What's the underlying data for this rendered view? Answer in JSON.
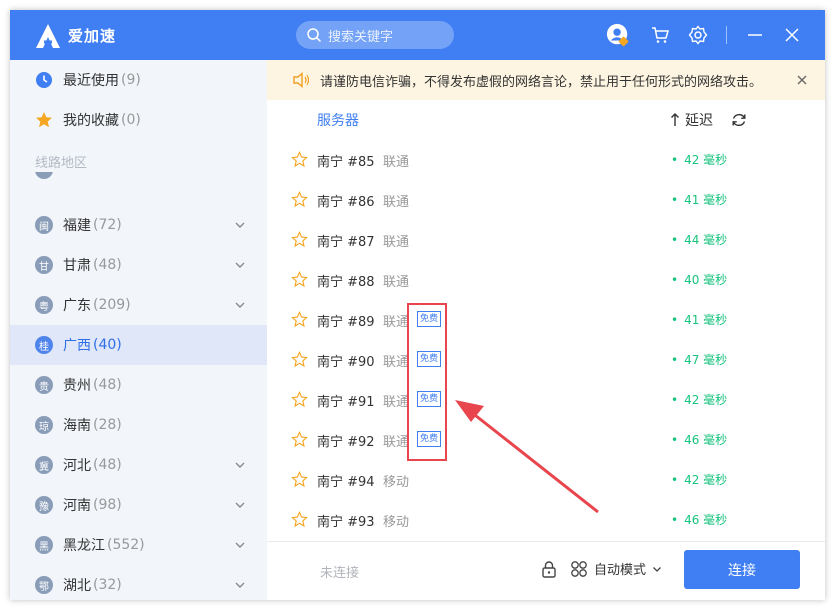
{
  "header": {
    "app_title": "爱加速",
    "search_placeholder": "搜索关键字"
  },
  "sidebar": {
    "recent": {
      "label": "最近使用",
      "count": "(9)"
    },
    "favorites": {
      "label": "我的收藏",
      "count": "(0)"
    },
    "section_title": "线路地区",
    "provinces": [
      {
        "badge": "闽",
        "label": "福建",
        "count": "(72)",
        "expandable": true
      },
      {
        "badge": "甘",
        "label": "甘肃",
        "count": "(48)",
        "expandable": true
      },
      {
        "badge": "粤",
        "label": "广东",
        "count": "(209)",
        "expandable": true
      },
      {
        "badge": "桂",
        "label": "广西",
        "count": "(40)",
        "expandable": false,
        "active": true
      },
      {
        "badge": "贵",
        "label": "贵州",
        "count": "(48)",
        "expandable": false
      },
      {
        "badge": "琼",
        "label": "海南",
        "count": "(28)",
        "expandable": false
      },
      {
        "badge": "冀",
        "label": "河北",
        "count": "(48)",
        "expandable": true
      },
      {
        "badge": "豫",
        "label": "河南",
        "count": "(98)",
        "expandable": true
      },
      {
        "badge": "黑",
        "label": "黑龙江",
        "count": "(552)",
        "expandable": true
      },
      {
        "badge": "鄂",
        "label": "湖北",
        "count": "(32)",
        "expandable": true
      }
    ]
  },
  "notice": {
    "text": "请谨防电信诈骗，不得发布虚假的网络言论，禁止用于任何形式的网络攻击。"
  },
  "table": {
    "col_server": "服务器",
    "col_latency": "延迟",
    "free_tag": "免费",
    "rows": [
      {
        "name": "南宁 #85",
        "isp": "联通",
        "free": false,
        "latency": "42 毫秒"
      },
      {
        "name": "南宁 #86",
        "isp": "联通",
        "free": false,
        "latency": "41 毫秒"
      },
      {
        "name": "南宁 #87",
        "isp": "联通",
        "free": false,
        "latency": "44 毫秒"
      },
      {
        "name": "南宁 #88",
        "isp": "联通",
        "free": false,
        "latency": "40 毫秒"
      },
      {
        "name": "南宁 #89",
        "isp": "联通",
        "free": true,
        "latency": "41 毫秒"
      },
      {
        "name": "南宁 #90",
        "isp": "联通",
        "free": true,
        "latency": "47 毫秒"
      },
      {
        "name": "南宁 #91",
        "isp": "联通",
        "free": true,
        "latency": "42 毫秒"
      },
      {
        "name": "南宁 #92",
        "isp": "联通",
        "free": true,
        "latency": "46 毫秒"
      },
      {
        "name": "南宁 #94",
        "isp": "移动",
        "free": false,
        "latency": "42 毫秒"
      },
      {
        "name": "南宁 #93",
        "isp": "移动",
        "free": false,
        "latency": "46 毫秒"
      }
    ]
  },
  "footer": {
    "status": "未连接",
    "mode": "自动模式",
    "connect_label": "连接"
  },
  "colors": {
    "primary": "#3f7ef3",
    "latency_green": "#19c37d",
    "highlight_red": "#e8454d",
    "star_orange": "#f5a623"
  },
  "icons": [
    "logo-icon",
    "search-icon",
    "avatar-icon",
    "cart-icon",
    "gear-icon",
    "minimize-icon",
    "close-icon",
    "clock-icon",
    "star-icon",
    "speaker-icon",
    "refresh-icon",
    "lock-icon",
    "grid-icon",
    "chevron-down-icon"
  ]
}
